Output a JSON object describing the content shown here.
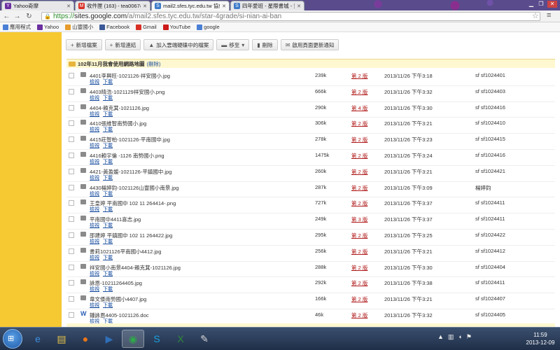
{
  "tabs": [
    {
      "label": "Yahoo奇摩",
      "favicon_color": "#6b2fa0",
      "favicon": "Y"
    },
    {
      "label": "收件匣 (163) - tea0067@",
      "favicon_color": "#d93025",
      "favicon": "M"
    },
    {
      "label": "mail2.sfes.tyc.edu.tw 協作",
      "favicon_color": "#3c7ac9",
      "favicon": "S"
    },
    {
      "label": "四年愛班 - 星際書城 - 資訊",
      "favicon_color": "#3c7ac9",
      "favicon": "S"
    }
  ],
  "address": {
    "scheme": "https://",
    "host": "sites.google.com",
    "path": "/a/mail2.sfes.tyc.edu.tw/star-4grade/si-nian-ai-ban"
  },
  "bookmarks": [
    {
      "label": "應用程式",
      "color": "#4a7fd6"
    },
    {
      "label": "Yahoo",
      "color": "#6b2fa0"
    },
    {
      "label": "山豐國小",
      "color": "#e69b2c"
    },
    {
      "label": "Facebook",
      "color": "#3b5998"
    },
    {
      "label": "Gmail",
      "color": "#d93025"
    },
    {
      "label": "YouTube",
      "color": "#cc1a1a"
    },
    {
      "label": "google",
      "color": "#4a7fd6"
    }
  ],
  "toolbar": [
    {
      "label": "新增檔案",
      "icon": "+"
    },
    {
      "label": "新增連結",
      "icon": "+"
    },
    {
      "label": "加入雲端硬碟中的檔案",
      "icon": "▲"
    },
    {
      "label": "移至",
      "icon": "▬",
      "dropdown": "▾"
    },
    {
      "label": "刪除",
      "icon": "▮"
    },
    {
      "label": "啟用頁面更新通知",
      "icon": "✉"
    }
  ],
  "folder": {
    "title": "102年11月我會使用網路地圖",
    "delete_label": "(刪除)"
  },
  "actions": {
    "view": "檢視",
    "download": "下載"
  },
  "files": [
    {
      "name": "4401李興旺-1021126-祥安國小.jpg",
      "size": "239k",
      "version": "第 2 版",
      "date": "2013/11/26 下午3:18",
      "user": "sf sf1024401",
      "type": "img"
    },
    {
      "name": "4403晴浩-1021129祥安國小.png",
      "size": "666k",
      "version": "第 2 版",
      "date": "2013/11/26 下午3:32",
      "user": "sf sf1024403",
      "type": "img"
    },
    {
      "name": "4404-賴克萁-1021126.jpg",
      "size": "290k",
      "version": "第 4 版",
      "date": "2013/11/26 下午3:30",
      "user": "sf sf1024416",
      "type": "img"
    },
    {
      "name": "4410張維智南勢國小.jpg",
      "size": "306k",
      "version": "第 2 版",
      "date": "2013/11/26 下午3:21",
      "user": "sf sf1024410",
      "type": "img"
    },
    {
      "name": "4415莊智柏-1021126-平南國中.jpg",
      "size": "278k",
      "version": "第 2 版",
      "date": "2013/11/26 下午3:23",
      "user": "sf sf1024415",
      "type": "img"
    },
    {
      "name": "4416賴宇倫 -1126 南勢國小.png",
      "size": "1475k",
      "version": "第 2 版",
      "date": "2013/11/26 下午3:24",
      "user": "sf sf1024416",
      "type": "img"
    },
    {
      "name": "4421-黃盈媛-1021126-平鎮國中.jpg",
      "size": "260k",
      "version": "第 2 版",
      "date": "2013/11/26 下午3:21",
      "user": "sf sf1024421",
      "type": "img"
    },
    {
      "name": "4430楊婷鈞-1021126山豐國小南景.jpg",
      "size": "287k",
      "version": "第 2 版",
      "date": "2013/11/26 下午3:09",
      "user": "楊婷鈞",
      "type": "img"
    },
    {
      "name": "王皇婷 平南國中 102 11 264414-.png",
      "size": "727k",
      "version": "第 2 版",
      "date": "2013/11/26 下午3:37",
      "user": "sf sf1024411",
      "type": "img"
    },
    {
      "name": "平南國中4411喜志.jpg",
      "size": "249k",
      "version": "第 3 版",
      "date": "2013/11/26 下午3:37",
      "user": "sf sf1024411",
      "type": "img"
    },
    {
      "name": "邵建婷 平鎮國中 102 11 264422.jpg",
      "size": "295k",
      "version": "第 2 版",
      "date": "2013/11/26 下午3:25",
      "user": "sf sf1024422",
      "type": "img"
    },
    {
      "name": "書莉1021126平南國小4412.jpg",
      "size": "256k",
      "version": "第 2 版",
      "date": "2013/11/26 下午3:21",
      "user": "sf sf1024412",
      "type": "img"
    },
    {
      "name": "祥安國小南景4404-賴克萁-1021126.jpg",
      "size": "288k",
      "version": "第 2 版",
      "date": "2013/11/26 下午3:30",
      "user": "sf sf1024404",
      "type": "img"
    },
    {
      "name": "詠恩-10211264405.jpg",
      "size": "292k",
      "version": "第 2 版",
      "date": "2013/11/26 下午3:38",
      "user": "sf sf1024411",
      "type": "img"
    },
    {
      "name": "韋文倭南勢國小4407.jpg",
      "size": "166k",
      "version": "第 2 版",
      "date": "2013/11/26 下午3:21",
      "user": "sf sf1024407",
      "type": "img"
    },
    {
      "name": "鍾詠恩4405-1021126.doc",
      "size": "46k",
      "version": "第 2 版",
      "date": "2013/11/26 下午3:32",
      "user": "sf sf1024405",
      "type": "doc"
    }
  ],
  "taskbar": {
    "apps": [
      {
        "name": "ie",
        "glyph": "e",
        "color": "#3b8fe0"
      },
      {
        "name": "explorer",
        "glyph": "▤",
        "color": "#e8c34a"
      },
      {
        "name": "firefox",
        "glyph": "●",
        "color": "#e8751a"
      },
      {
        "name": "media",
        "glyph": "▶",
        "color": "#2f6fb8"
      },
      {
        "name": "chrome",
        "glyph": "◉",
        "color": "#2fa84a"
      },
      {
        "name": "skype",
        "glyph": "S",
        "color": "#1aa0e0"
      },
      {
        "name": "excel",
        "glyph": "X",
        "color": "#2f8a3a"
      },
      {
        "name": "paint",
        "glyph": "✎",
        "color": "#d8d8d8"
      }
    ],
    "clock_time": "11:59",
    "clock_date": "2013-12-09"
  }
}
